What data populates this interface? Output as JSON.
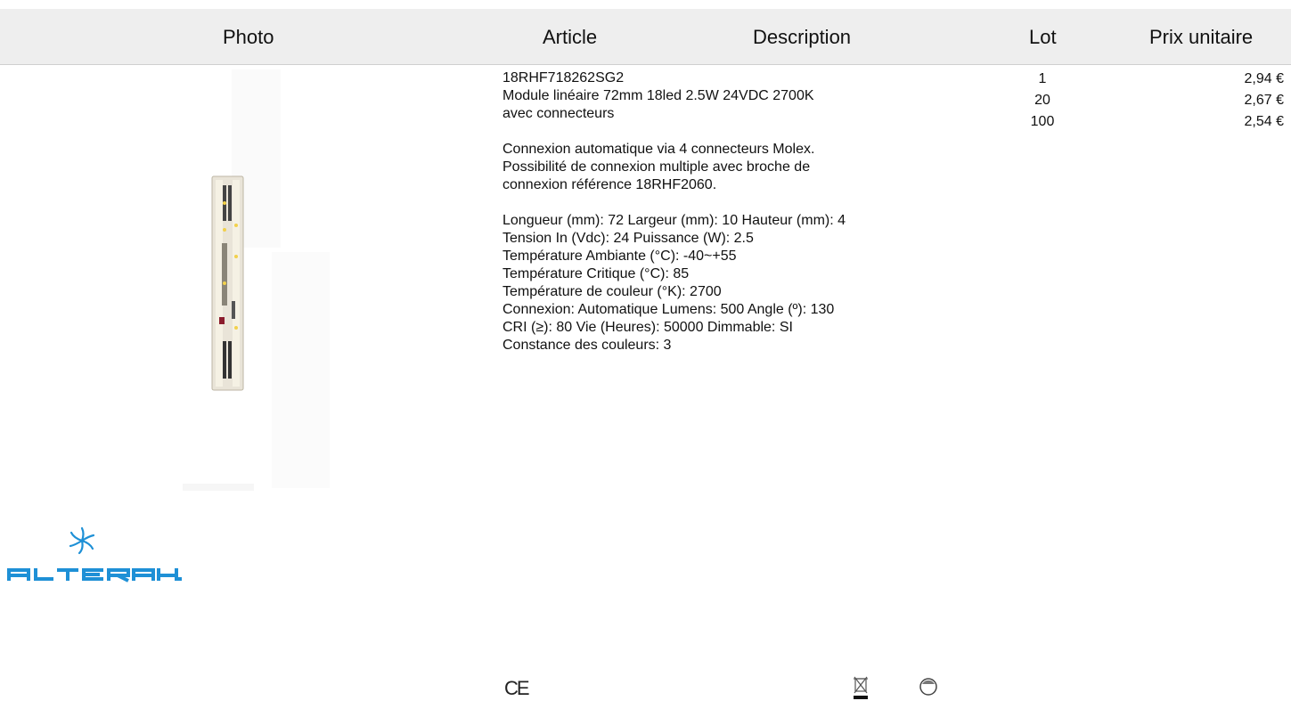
{
  "header": {
    "photo": "Photo",
    "article": "Article",
    "description": "Description",
    "lot": "Lot",
    "prix": "Prix unitaire"
  },
  "product": {
    "reference": "18RHF718262SG2",
    "name_lines": [
      "Module linéaire 72mm 18led 2.5W 24VDC 2700K",
      "avec connecteurs"
    ],
    "connection_lines": [
      "Connexion automatique via 4 connecteurs Molex.",
      "Possibilité de connexion multiple avec broche de",
      "connexion référence 18RHF2060."
    ],
    "spec_lines": [
      "Longueur (mm): 72 Largeur (mm): 10 Hauteur (mm): 4",
      "Tension In (Vdc): 24 Puissance (W): 2.5",
      "Température Ambiante (°C): -40~+55",
      "Température Critique (°C): 85",
      "Température de couleur (°K): 2700",
      "Connexion: Automatique Lumens: 500 Angle (º): 130",
      "CRI (≥): 80 Vie (Heures): 50000 Dimmable: SI",
      "Constance des couleurs: 3"
    ]
  },
  "pricing": [
    {
      "lot": "1",
      "price": "2,94 €"
    },
    {
      "lot": "20",
      "price": "2,67 €"
    },
    {
      "lot": "100",
      "price": "2,54 €"
    }
  ],
  "brand": {
    "name": "ALTERAH",
    "color": "#1e90d6"
  },
  "icons": [
    "led-module-photo",
    "alterah-logo",
    "ce-mark-icon",
    "weee-bin-icon",
    "recycle-circle-icon"
  ],
  "certification": {
    "ce": "CE"
  }
}
